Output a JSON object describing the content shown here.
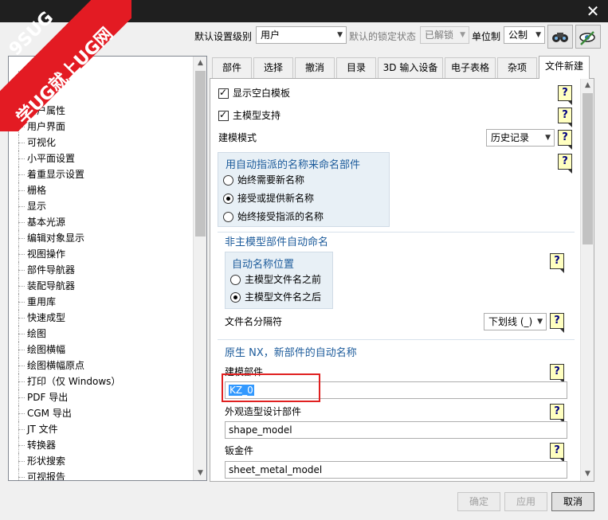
{
  "window": {
    "close_glyph": "✕"
  },
  "watermark": {
    "line1": "9SUG",
    "line2": "学UG就上UG网"
  },
  "toolbar": {
    "default_level_label": "默认设置级别",
    "default_level_value": "用户",
    "lock_status_label": "默认的锁定状态",
    "lock_status_value": "已解锁",
    "unit_label": "单位制",
    "unit_value": "公制",
    "icon1": "binoculars-icon",
    "icon2": "eye-settings-icon"
  },
  "sidebar": {
    "items": [
      {
        "label": ""
      },
      {
        "label": "对象"
      },
      {
        "label": "用户属性"
      },
      {
        "label": "用户界面"
      },
      {
        "label": "可视化"
      },
      {
        "label": "小平面设置"
      },
      {
        "label": "着重显示设置"
      },
      {
        "label": "栅格"
      },
      {
        "label": "显示"
      },
      {
        "label": "基本光源"
      },
      {
        "label": "编辑对象显示"
      },
      {
        "label": "视图操作"
      },
      {
        "label": "部件导航器"
      },
      {
        "label": "装配导航器"
      },
      {
        "label": "重用库"
      },
      {
        "label": "快速成型"
      },
      {
        "label": "绘图"
      },
      {
        "label": "绘图横幅"
      },
      {
        "label": "绘图横幅原点"
      },
      {
        "label": "打印（仅 Windows）"
      },
      {
        "label": "PDF 导出"
      },
      {
        "label": "CGM 导出"
      },
      {
        "label": "JT 文件"
      },
      {
        "label": "转换器"
      },
      {
        "label": "形状搜索"
      },
      {
        "label": "可视报告"
      }
    ]
  },
  "tabs": [
    {
      "label": "部件"
    },
    {
      "label": "选择"
    },
    {
      "label": "撤消"
    },
    {
      "label": "目录"
    },
    {
      "label": "3D 输入设备"
    },
    {
      "label": "电子表格"
    },
    {
      "label": "杂项"
    },
    {
      "label": "文件新建"
    }
  ],
  "content": {
    "show_blank_template": "显示空白模板",
    "master_model_support": "主模型支持",
    "modeling_mode_label": "建模模式",
    "modeling_mode_value": "历史记录",
    "auto_naming_group_title": "用自动指派的名称来命名部件",
    "auto_naming_options": [
      "始终需要新名称",
      "接受或提供新名称",
      "始终接受指派的名称"
    ],
    "non_master_section": "非主模型部件自动命名",
    "auto_name_position_title": "自动名称位置",
    "auto_name_position_options": [
      "主模型文件名之前",
      "主模型文件名之后"
    ],
    "filename_separator_label": "文件名分隔符",
    "filename_separator_value": "下划线 (_)",
    "native_nx_section": "原生 NX，新部件的自动名称",
    "modeling_part_label": "建模部件",
    "modeling_part_value": "KZ_0",
    "shape_design_label": "外观造型设计部件",
    "shape_design_value": "shape_model",
    "sheet_metal_label": "钣金件",
    "sheet_metal_value": "sheet_metal_model",
    "help_glyph": "?"
  },
  "buttons": {
    "ok": "确定",
    "apply": "应用",
    "cancel": "取消"
  },
  "colors": {
    "accent_blue": "#1c5b9b",
    "selection": "#3399ff",
    "highlight_red": "#e02020",
    "watermark_red": "#e31b23"
  }
}
